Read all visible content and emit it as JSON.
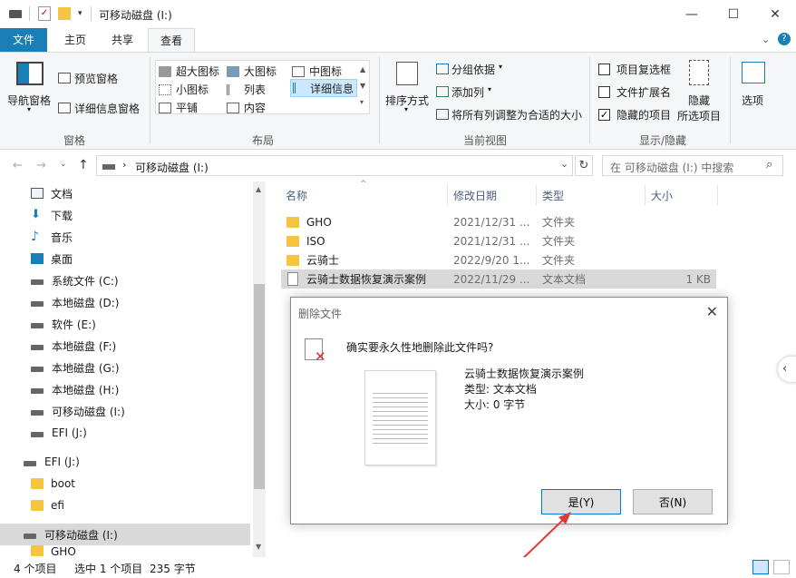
{
  "window": {
    "title": "可移动磁盘 (I:)",
    "minimize": "—",
    "maximize": "☐",
    "close": "✕"
  },
  "ribbon_tabs": {
    "file": "文件",
    "home": "主页",
    "share": "共享",
    "view": "查看"
  },
  "ribbon": {
    "panes": {
      "nav_pane": "导航窗格",
      "preview_pane": "预览窗格",
      "details_pane": "详细信息窗格",
      "group": "窗格"
    },
    "layout": {
      "extra_large": "超大图标",
      "large": "大图标",
      "medium": "中图标",
      "small": "小图标",
      "list": "列表",
      "details": "详细信息",
      "tiles": "平铺",
      "content": "内容",
      "group": "布局"
    },
    "current_view": {
      "sort_by": "排序方式",
      "group_by": "分组依据",
      "add_columns": "添加列",
      "size_all_columns": "将所有列调整为合适的大小",
      "group": "当前视图"
    },
    "show_hide": {
      "item_checkboxes": "项目复选框",
      "file_extensions": "文件扩展名",
      "hidden_items": "隐藏的项目",
      "hide_selected_1": "隐藏",
      "hide_selected_2": "所选项目",
      "options": "选项",
      "group": "显示/隐藏",
      "item_checkboxes_checked": false,
      "file_extensions_checked": false,
      "hidden_items_checked": true
    }
  },
  "address": {
    "path": "可移动磁盘 (I:)",
    "search_placeholder": "在 可移动磁盘 (I:) 中搜索"
  },
  "nav": {
    "items": [
      {
        "label": "文档",
        "icon": "document-icon"
      },
      {
        "label": "下载",
        "icon": "download-icon"
      },
      {
        "label": "音乐",
        "icon": "music-icon"
      },
      {
        "label": "桌面",
        "icon": "desktop-icon"
      },
      {
        "label": "系统文件 (C:)",
        "icon": "system-drive-icon"
      },
      {
        "label": "本地磁盘 (D:)",
        "icon": "drive-icon"
      },
      {
        "label": "软件 (E:)",
        "icon": "drive-icon"
      },
      {
        "label": "本地磁盘 (F:)",
        "icon": "drive-icon"
      },
      {
        "label": "本地磁盘 (G:)",
        "icon": "drive-icon"
      },
      {
        "label": "本地磁盘 (H:)",
        "icon": "drive-icon"
      },
      {
        "label": "可移动磁盘 (I:)",
        "icon": "drive-icon"
      },
      {
        "label": "EFI (J:)",
        "icon": "drive-icon"
      }
    ],
    "efi_section": "EFI (J:)",
    "efi_children": [
      "boot",
      "efi"
    ],
    "removable_section": "可移动磁盘 (I:)",
    "removable_child": "GHO"
  },
  "columns": {
    "name": "名称",
    "date": "修改日期",
    "type": "类型",
    "size": "大小"
  },
  "files": [
    {
      "name": "GHO",
      "date": "2021/12/31 ...",
      "type": "文件夹",
      "size": "",
      "kind": "folder"
    },
    {
      "name": "ISO",
      "date": "2021/12/31 ...",
      "type": "文件夹",
      "size": "",
      "kind": "folder"
    },
    {
      "name": "云骑士",
      "date": "2022/9/20 1...",
      "type": "文件夹",
      "size": "",
      "kind": "folder"
    },
    {
      "name": "云骑士数据恢复演示案例",
      "date": "2022/11/29 ...",
      "type": "文本文档",
      "size": "1 KB",
      "kind": "text"
    }
  ],
  "dialog": {
    "title": "删除文件",
    "question": "确实要永久性地删除此文件吗?",
    "file_name": "云骑士数据恢复演示案例",
    "file_type": "类型: 文本文档",
    "file_size": "大小: 0 字节",
    "yes": "是(Y)",
    "no": "否(N)"
  },
  "status": {
    "count": "4 个项目",
    "selected": "选中 1 个项目",
    "size": "235 字节"
  },
  "colors": {
    "accent": "#1a7fb6",
    "arrow": "#e53935"
  }
}
